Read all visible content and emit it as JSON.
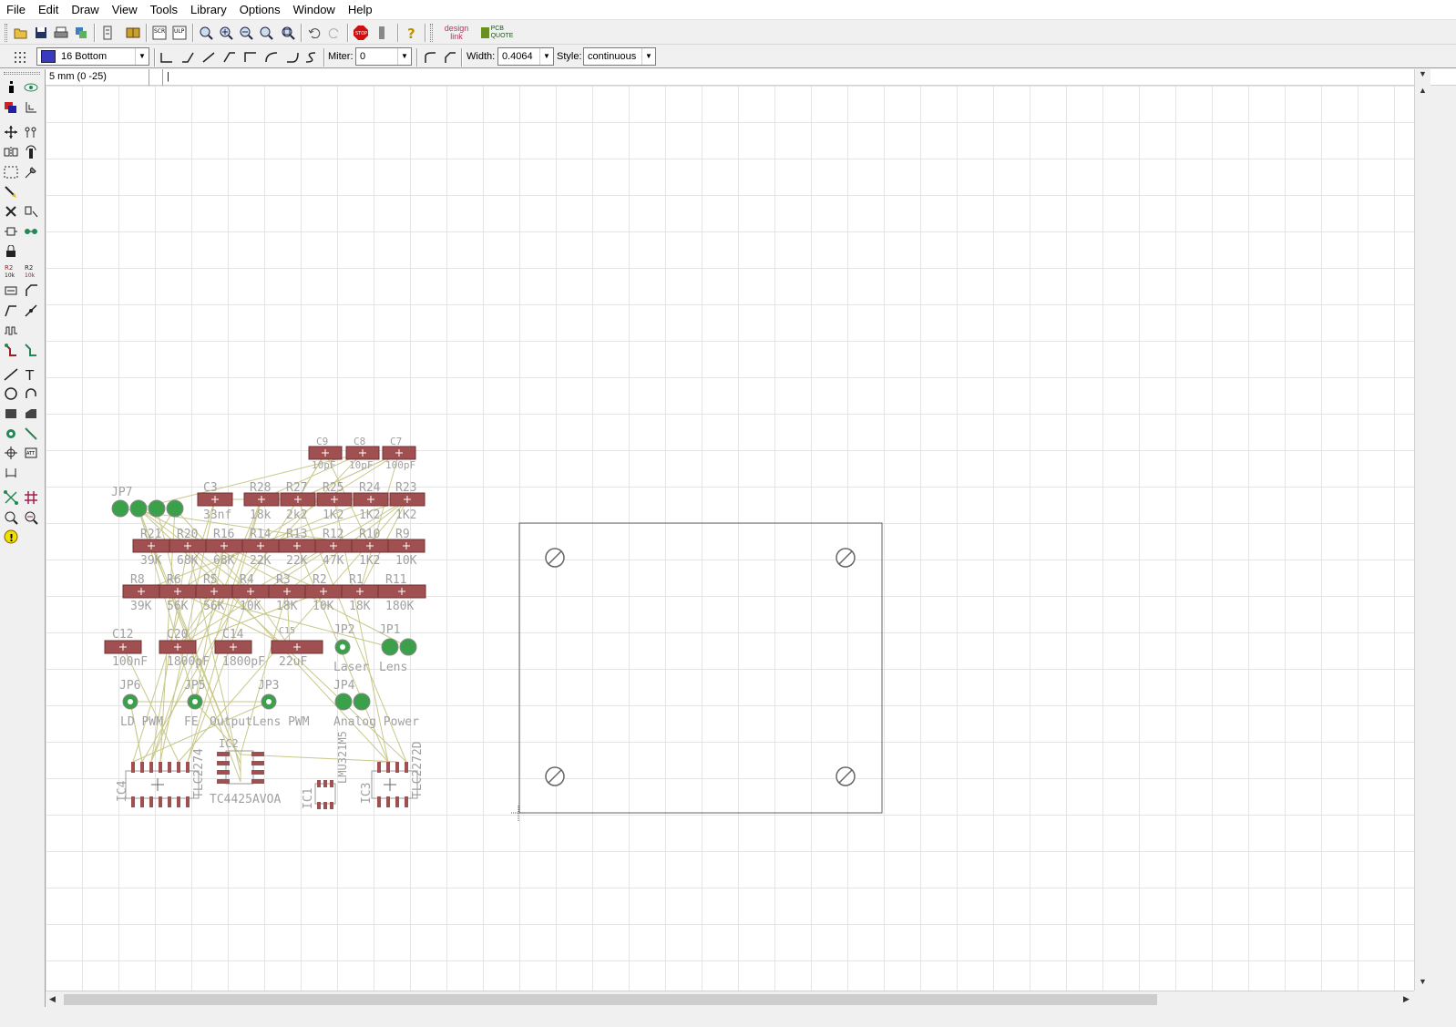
{
  "menu": [
    "File",
    "Edit",
    "Draw",
    "View",
    "Tools",
    "Library",
    "Options",
    "Window",
    "Help"
  ],
  "toolbar": {
    "layer_value": "16 Bottom",
    "miter_label": "Miter:",
    "miter_value": "0",
    "width_label": "Width:",
    "width_value": "0.4064",
    "style_label": "Style:",
    "style_value": "continuous",
    "designlink_label": "design link",
    "pcbquote_label": "PCB QUOTE"
  },
  "command": {
    "coordinate": "5 mm (0 -25)",
    "input": "|"
  },
  "board": {
    "components": {
      "caps_top": [
        {
          "name": "C9",
          "value": "10pF"
        },
        {
          "name": "C8",
          "value": "10pF"
        },
        {
          "name": "C7",
          "value": "100pF"
        }
      ],
      "row1": [
        {
          "name": "JP7"
        },
        {
          "name": "C3",
          "value": "33nf"
        },
        {
          "name": "R28",
          "value": "18k"
        },
        {
          "name": "R27",
          "value": "2k2"
        },
        {
          "name": "R25",
          "value": "1K2"
        },
        {
          "name": "R24",
          "value": "1K2"
        },
        {
          "name": "R23",
          "value": "1K2"
        }
      ],
      "row2": [
        {
          "name": "R21",
          "value": "39K"
        },
        {
          "name": "R20",
          "value": "68K"
        },
        {
          "name": "R16",
          "value": "68K"
        },
        {
          "name": "R14",
          "value": "22K"
        },
        {
          "name": "R13",
          "value": "22K"
        },
        {
          "name": "R12",
          "value": "47K"
        },
        {
          "name": "R10",
          "value": "1K2"
        },
        {
          "name": "R9",
          "value": "10K"
        }
      ],
      "row3": [
        {
          "name": "R8",
          "value": "39K"
        },
        {
          "name": "R6",
          "value": "56K"
        },
        {
          "name": "R5",
          "value": "56K"
        },
        {
          "name": "R4",
          "value": "10K"
        },
        {
          "name": "R3",
          "value": "18K"
        },
        {
          "name": "R2",
          "value": "10K"
        },
        {
          "name": "R1",
          "value": "18K"
        },
        {
          "name": "R11",
          "value": "180K"
        }
      ],
      "row4": [
        {
          "name": "C12",
          "value": "100nF"
        },
        {
          "name": "C20",
          "value": "1800pF"
        },
        {
          "name": "C14",
          "value": "1800pF"
        },
        {
          "name": "C15",
          "value": "22uF"
        },
        {
          "name": "JP2",
          "value": "Laser"
        },
        {
          "name": "JP1",
          "value": "Lens"
        }
      ],
      "row5": [
        {
          "name": "JP6",
          "value": "LD PWM"
        },
        {
          "name": "JP5",
          "value": "FE"
        },
        {
          "name": "JP3",
          "value": "OutputLens PWM"
        },
        {
          "name": "JP4",
          "value": "Analog Power"
        }
      ],
      "ics": [
        {
          "name": "IC4",
          "value": "TLC2274"
        },
        {
          "name": "IC2",
          "value": "TC4425AVOA"
        },
        {
          "name": "IC1",
          "value": "LMU321M5"
        },
        {
          "name": "IC3",
          "value": "TLC2272D"
        }
      ]
    }
  },
  "colors": {
    "pad_red": "#a05050",
    "pad_green": "#3aa14a",
    "airwire": "#c8c88a",
    "silk": "#a0a0a0",
    "outline": "#666666"
  }
}
